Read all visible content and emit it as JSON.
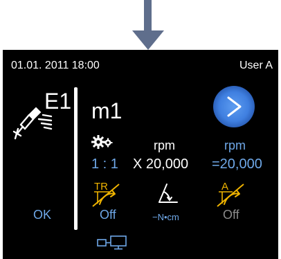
{
  "status_bar": {
    "datetime": "01.01. 2011 18:00",
    "user": "User A"
  },
  "tool": {
    "label": "E1",
    "icon": "handpiece-icon"
  },
  "program": {
    "name": "m1"
  },
  "gear": {
    "icon": "gear-icon",
    "ratio": "1 : 1"
  },
  "speed": {
    "motor_unit": "rpm",
    "multiplier": "X 20,000",
    "output_unit": "rpm",
    "output_value": "=20,000"
  },
  "torque_reverse": {
    "label": "TR",
    "state": "Off"
  },
  "torque": {
    "icon": "angle-torque-icon",
    "unit": "−N•cm"
  },
  "auto_reverse": {
    "label": "A",
    "state": "Off"
  },
  "ok_label": "OK",
  "connection": {
    "icon": "pc-link-icon"
  },
  "colors": {
    "accent": "#6fa8e8",
    "button": "#3f7fe0",
    "icon_yellow": "#f0b400",
    "arrow": "#5f6e8c"
  }
}
